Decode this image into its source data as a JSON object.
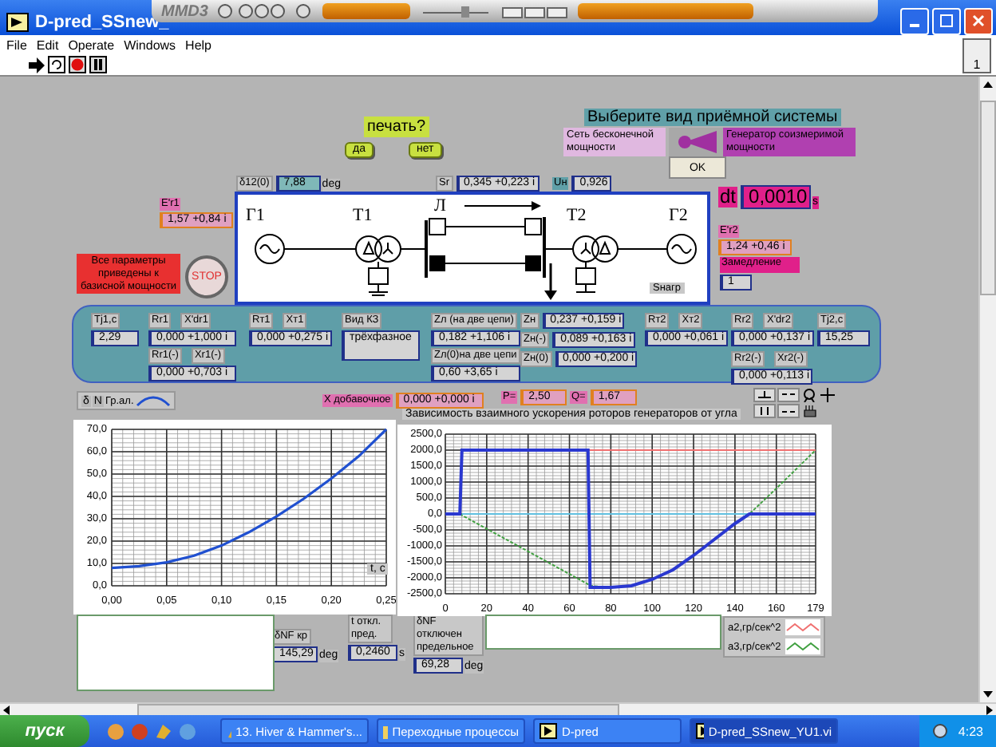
{
  "window": {
    "title": "D-pred_SSnew_",
    "menu": [
      "File",
      "Edit",
      "Operate",
      "Windows",
      "Help"
    ],
    "page_indicator": "1"
  },
  "media_player": {
    "logo": "MMD3"
  },
  "front_panel": {
    "print_prompt": {
      "label": "печать?",
      "buttons": [
        "да",
        "нет"
      ]
    },
    "system_choice": {
      "title": "Выберите вид приёмной системы",
      "options": [
        {
          "label": "Сеть бесконечной мощности",
          "selected": false
        },
        {
          "label": "Генератор соизмеримой мощности",
          "selected": true
        }
      ],
      "ok": "OK"
    },
    "notice": "Все параметры приведены к базисной мощности",
    "stop": "STOP",
    "scheme": {
      "labels": [
        "Г1",
        "Т1",
        "Л",
        "Т2",
        "Г2"
      ],
      "load": "Sнагр"
    },
    "indicators": [
      {
        "labels": [
          "δ12(0)"
        ],
        "value": "7,88",
        "unit": "deg"
      },
      {
        "labels": [
          "Sr"
        ],
        "value": "0,345 +0,223 i"
      },
      {
        "labels": [
          "Uн"
        ],
        "value": "0,926"
      },
      {
        "labels": [
          "E'r1"
        ],
        "value": "1,57 +0,84 i"
      },
      {
        "labels": [
          "dt"
        ],
        "value": "0,0010",
        "unit": "s"
      },
      {
        "labels": [
          "E'r2"
        ],
        "value": "1,24 +0,46 i"
      },
      {
        "labels": [
          "Замедление"
        ],
        "value": "1"
      },
      {
        "labels": [
          "X добавочное"
        ],
        "value": "0,000 +0,000 i"
      },
      {
        "labels": [
          "P="
        ],
        "value": "2,50"
      },
      {
        "labels": [
          "Q="
        ],
        "value": "1,67"
      },
      {
        "labels": [
          "δNF кр"
        ],
        "value": "145,29",
        "unit": "deg"
      },
      {
        "labels": [
          "t откл. пред."
        ],
        "value": "0,2460",
        "unit": "s"
      },
      {
        "labels": [
          "δNF отключен предельное"
        ],
        "value": "69,28",
        "unit": "deg"
      }
    ],
    "parameters": [
      {
        "kind": "numeric",
        "labels": [
          "Tj1,c"
        ],
        "value": "2,29"
      },
      {
        "kind": "numeric",
        "labels": [
          "Rr1",
          "X'dr1"
        ],
        "value": "0,000 +1,000 i"
      },
      {
        "kind": "numeric",
        "labels": [
          "Rr1(-)",
          "Xr1(-)"
        ],
        "value": "0,000 +0,703 i"
      },
      {
        "kind": "numeric",
        "labels": [
          "Rт1",
          "Xт1"
        ],
        "value": "0,000 +0,275 i"
      },
      {
        "kind": "dropdown",
        "labels": [
          "Вид КЗ"
        ],
        "value": "трёхфазное"
      },
      {
        "kind": "numeric",
        "labels": [
          "Zл (на две цепи)"
        ],
        "value": "0,182 +1,106 i"
      },
      {
        "kind": "numeric",
        "labels": [
          "Zл(0)на две цепи"
        ],
        "value": "0,60 +3,65 i"
      },
      {
        "kind": "numeric",
        "labels": [
          "Zн"
        ],
        "value": "0,237 +0,159 i"
      },
      {
        "kind": "numeric",
        "labels": [
          "Zн(-)"
        ],
        "value": "0,089 +0,163 i"
      },
      {
        "kind": "numeric",
        "labels": [
          "Zн(0)"
        ],
        "value": "0,000 +0,200 i"
      },
      {
        "kind": "numeric",
        "labels": [
          "Rт2",
          "Xт2"
        ],
        "value": "0,000 +0,061 i"
      },
      {
        "kind": "numeric",
        "labels": [
          "Rr2",
          "X'dr2"
        ],
        "value": "0,000 +0,137 i"
      },
      {
        "kind": "numeric",
        "labels": [
          "Tj2,c"
        ],
        "value": "15,25"
      },
      {
        "kind": "numeric",
        "labels": [
          "Rr2(-)",
          "Xr2(-)"
        ],
        "value": "0,000 +0,113 i"
      }
    ],
    "angle_graph": {
      "legend_tags": [
        "δ",
        "N"
      ],
      "chart_data": {
        "type": "line",
        "xlabel": "t, c",
        "x": [
          0,
          0.025,
          0.05,
          0.075,
          0.1,
          0.125,
          0.15,
          0.175,
          0.2,
          0.225,
          0.25
        ],
        "grid": true,
        "series": [
          {
            "name": "Гр.ал.",
            "color": "#2050d0",
            "values": [
              8,
              8.8,
              10.5,
              13.5,
              18,
              24,
              31,
              39,
              48,
              58,
              70
            ]
          }
        ],
        "xlim": [
          0,
          0.25
        ],
        "ylim": [
          0,
          70
        ],
        "xticks": [
          {
            "value": 0,
            "label": "0,00"
          },
          {
            "value": 0.05,
            "label": "0,05"
          },
          {
            "value": 0.1,
            "label": "0,10"
          },
          {
            "value": 0.15,
            "label": "0,15"
          },
          {
            "value": 0.2,
            "label": "0,20"
          },
          {
            "value": 0.25,
            "label": "0,25"
          }
        ],
        "yticks": [
          {
            "value": 0,
            "label": "0,0"
          },
          {
            "value": 10,
            "label": "10,0"
          },
          {
            "value": 20,
            "label": "20,0"
          },
          {
            "value": 30,
            "label": "30,0"
          },
          {
            "value": 40,
            "label": "40,0"
          },
          {
            "value": 50,
            "label": "50,0"
          },
          {
            "value": 60,
            "label": "60,0"
          },
          {
            "value": 70,
            "label": "70,0"
          }
        ]
      }
    },
    "acceleration_graph": {
      "chart_data": {
        "type": "line",
        "title": "Зависимость взаимного ускорения роторов генераторов от угла",
        "x": [
          0,
          7,
          8,
          69,
          70,
          80,
          90,
          100,
          110,
          120,
          130,
          140,
          147,
          160,
          179
        ],
        "grid": true,
        "series": [
          {
            "name": "a2,гр/сек^2",
            "color": "#f07070",
            "values": [
              null,
              null,
              null,
              2000,
              2000,
              2000,
              2000,
              2000,
              2000,
              2000,
              2000,
              2000,
              2000,
              2000,
              2000
            ]
          },
          {
            "name": "a3,гр/сек^2",
            "color": "#40a040",
            "line_style": "dashed",
            "values": [
              null,
              0,
              -40,
              -2200,
              -2250,
              -2300,
              -2250,
              -2050,
              -1750,
              -1300,
              -800,
              -300,
              0,
              800,
              2000
            ]
          },
          {
            "color": "#60c0e0",
            "values": [
              null,
              null,
              0,
              0,
              0,
              0,
              0,
              0,
              0,
              0,
              0,
              0,
              0,
              null,
              null
            ]
          },
          {
            "color": "#2a38d0",
            "values": [
              0,
              0,
              2000,
              2000,
              -2300,
              -2300,
              -2250,
              -2050,
              -1750,
              -1300,
              -800,
              -300,
              0,
              0,
              0
            ]
          }
        ],
        "xlim": [
          0,
          179
        ],
        "ylim": [
          -2500,
          2500
        ],
        "xticks": [
          0,
          20,
          40,
          60,
          80,
          100,
          120,
          140,
          160,
          179
        ],
        "yticks": [
          {
            "value": -2500,
            "label": "-2500,0"
          },
          {
            "value": -2000,
            "label": "-2000,0"
          },
          {
            "value": -1500,
            "label": "-1500,0"
          },
          {
            "value": -1000,
            "label": "-1000,0"
          },
          {
            "value": -500,
            "label": "-500,0"
          },
          {
            "value": 0,
            "label": "0,0"
          },
          {
            "value": 500,
            "label": "500,0"
          },
          {
            "value": 1000,
            "label": "1000,0"
          },
          {
            "value": 1500,
            "label": "1500,0"
          },
          {
            "value": 2000,
            "label": "2000,0"
          },
          {
            "value": 2500,
            "label": "2500,0"
          }
        ]
      }
    }
  },
  "taskbar": {
    "start": "пуск",
    "tasks": [
      {
        "label": "13. Hiver & Hammer's...",
        "selected": false
      },
      {
        "label": "Переходные процессы",
        "selected": false
      },
      {
        "label": "D-pred",
        "selected": false
      },
      {
        "label": "D-pred_SSnew_YU1.vi",
        "selected": true
      }
    ],
    "clock": "4:23"
  }
}
